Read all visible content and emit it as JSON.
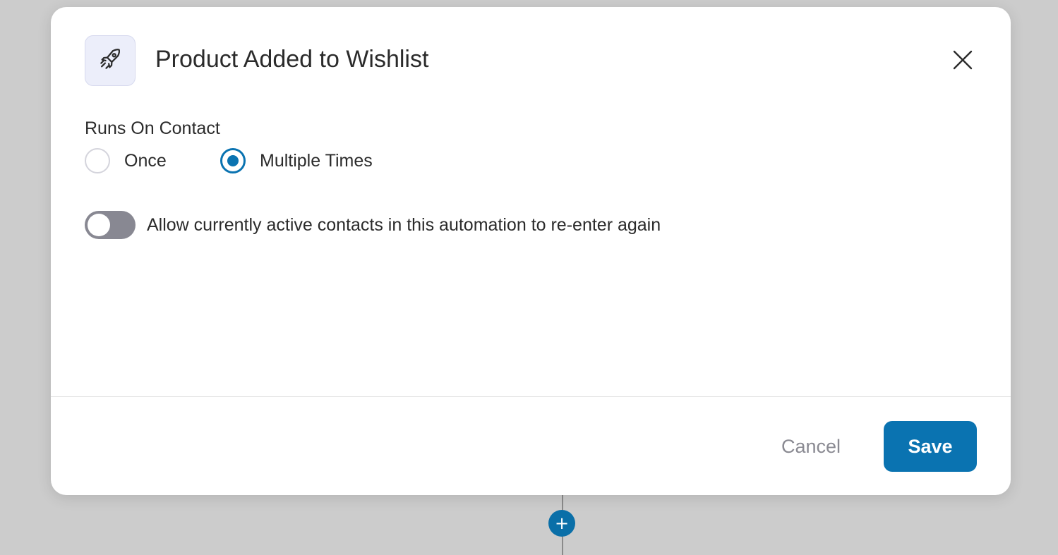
{
  "modal": {
    "title": "Product Added to Wishlist",
    "icon": "rocket-icon",
    "close_icon": "close-icon"
  },
  "runs_on_contact": {
    "label": "Runs On Contact",
    "options": [
      {
        "label": "Once",
        "selected": false
      },
      {
        "label": "Multiple Times",
        "selected": true
      }
    ]
  },
  "reenter_toggle": {
    "label": "Allow currently active contacts in this automation to re-enter again",
    "enabled": false
  },
  "footer": {
    "cancel_label": "Cancel",
    "save_label": "Save"
  },
  "canvas": {
    "add_step_symbol": "+"
  },
  "colors": {
    "accent": "#0a73b1",
    "toggle_off": "#888892",
    "backdrop": "#cccccc"
  }
}
